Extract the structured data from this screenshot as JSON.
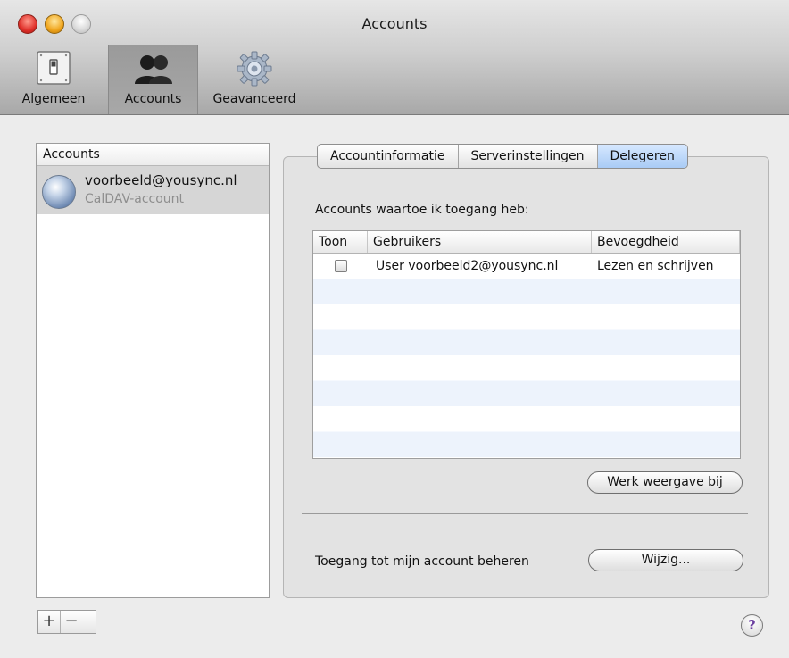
{
  "window": {
    "title": "Accounts"
  },
  "toolbar": {
    "items": [
      {
        "label": "Algemeen",
        "icon": "switch-icon"
      },
      {
        "label": "Accounts",
        "icon": "people-icon",
        "selected": true
      },
      {
        "label": "Geavanceerd",
        "icon": "gear-icon"
      }
    ]
  },
  "sidebar": {
    "header": "Accounts",
    "accounts": [
      {
        "name": "voorbeeld@yousync.nl",
        "type": "CalDAV-account",
        "icon": "globe-icon"
      }
    ],
    "add_label": "+",
    "remove_label": "−"
  },
  "tabs": [
    {
      "label": "Accountinformatie",
      "active": false
    },
    {
      "label": "Serverinstellingen",
      "active": false
    },
    {
      "label": "Delegeren",
      "active": true
    }
  ],
  "delegation": {
    "section_label": "Accounts waartoe ik toegang heb:",
    "columns": [
      "Toon",
      "Gebruikers",
      "Bevoegdheid"
    ],
    "rows": [
      {
        "show": false,
        "user": "User voorbeeld2@yousync.nl",
        "permission": "Lezen en schrijven"
      }
    ],
    "refresh_button": "Werk weergave bij",
    "access_label": "Toegang tot mijn account beheren",
    "edit_button": "Wijzig..."
  },
  "help_label": "?",
  "colors": {
    "selected_tab": "#a9cbf5",
    "list_selection": "#d6d6d6"
  }
}
